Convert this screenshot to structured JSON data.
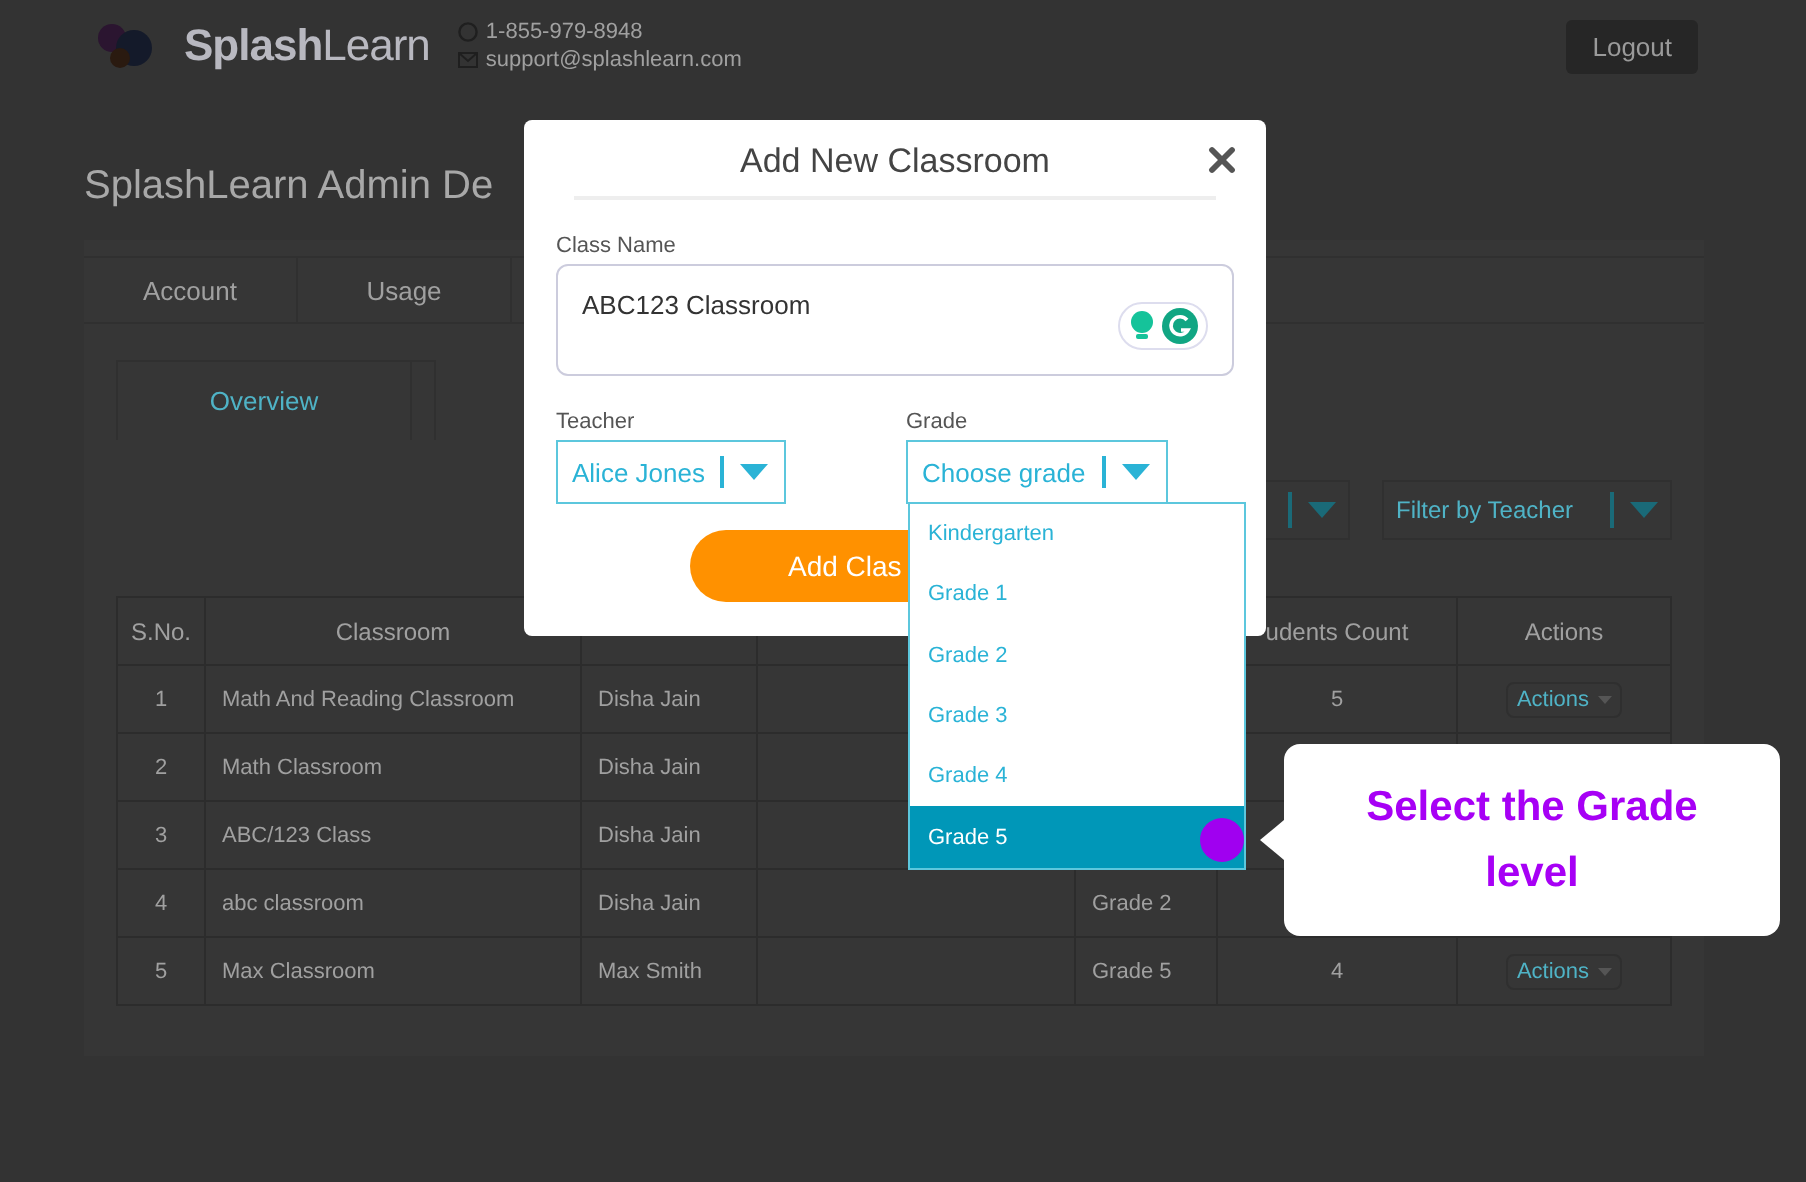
{
  "header": {
    "logo": "**Splash**Learn",
    "phone": "1-855-979-8948",
    "email": "support@splashlearn.com",
    "logout": "Logout"
  },
  "page_title": "SplashLearn Admin De",
  "tabs": [
    {
      "label": "Account"
    },
    {
      "label": "Usage"
    }
  ],
  "subtabs": [
    {
      "label": "Overview",
      "selected": true
    }
  ],
  "filters": [
    {
      "kind": "select"
    },
    {
      "kind": "select",
      "label": "Filter by Teacher"
    }
  ],
  "table": {
    "columns": [
      "S.No.",
      "Classroom",
      "",
      "",
      "",
      "udents Count",
      "Actions"
    ],
    "rows": [
      [
        "1",
        "Math And Reading Classroom",
        "Disha Jain",
        "",
        "",
        "5",
        "Actions"
      ],
      [
        "2",
        "Math Classroom",
        "Disha Jain",
        "",
        "",
        "",
        ""
      ],
      [
        "3",
        "ABC/123 Class",
        "Disha Jain",
        "",
        "",
        "",
        ""
      ],
      [
        "4",
        "abc classroom",
        "Disha Jain",
        "",
        "Grade 2",
        "",
        ""
      ],
      [
        "5",
        "Max Classroom",
        "Max Smith",
        "",
        "Grade 5",
        "4",
        "Actions"
      ]
    ]
  },
  "modal": {
    "title": "Add New Classroom",
    "class_name": {
      "label": "Class Name",
      "value": "ABC123 Classroom"
    },
    "teacher": {
      "label": "Teacher",
      "value": "Alice Jones"
    },
    "grade": {
      "label": "Grade",
      "placeholder": "Choose grade",
      "expanded": true,
      "options": [
        {
          "label": "Kindergarten",
          "selected": false
        },
        {
          "label": "Grade 1",
          "selected": false
        },
        {
          "label": "Grade 2",
          "selected": false
        },
        {
          "label": "Grade 3",
          "selected": false
        },
        {
          "label": "Grade 4",
          "selected": false
        },
        {
          "label": "Grade 5",
          "selected": true
        }
      ]
    },
    "submit": "Add Clas"
  },
  "callout": {
    "text": "Select the Grade level"
  }
}
